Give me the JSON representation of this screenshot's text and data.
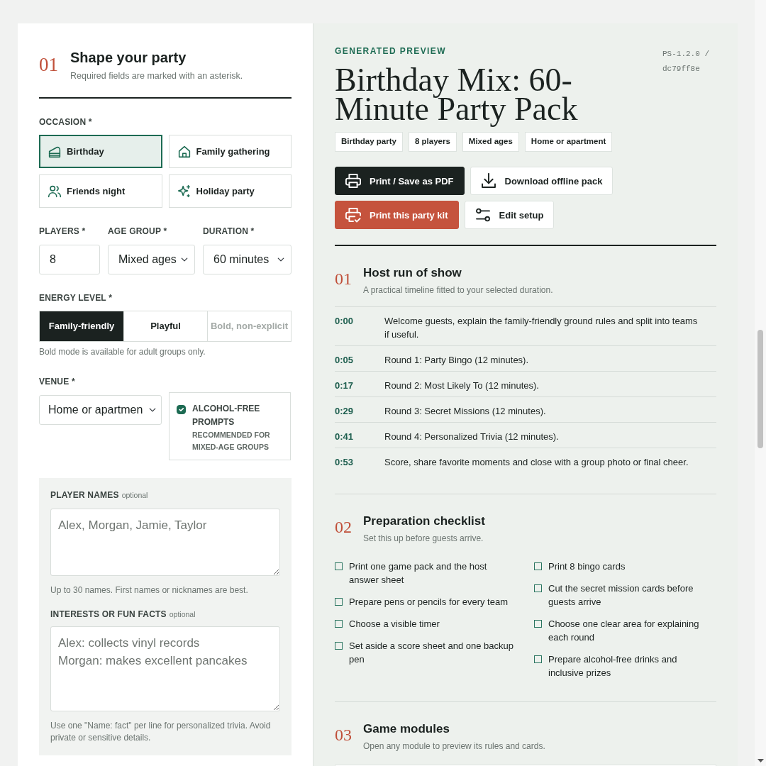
{
  "form": {
    "number": "01",
    "title": "Shape your party",
    "subtitle": "Required fields are marked with an asterisk.",
    "occasion": {
      "label": "OCCASION *",
      "options": [
        {
          "label": "Birthday",
          "selected": true
        },
        {
          "label": "Family gathering",
          "selected": false
        },
        {
          "label": "Friends night",
          "selected": false
        },
        {
          "label": "Holiday party",
          "selected": false
        }
      ]
    },
    "fields": [
      {
        "kind": "input",
        "label": "PLAYERS *",
        "value": "8"
      },
      {
        "kind": "select",
        "label": "AGE GROUP *",
        "value": "Mixed ages"
      },
      {
        "kind": "select",
        "label": "DURATION *",
        "value": "60 minutes"
      }
    ],
    "energy": {
      "label": "ENERGY LEVEL *",
      "options": [
        {
          "label": "Family-friendly",
          "selected": true,
          "disabled": false
        },
        {
          "label": "Playful",
          "selected": false,
          "disabled": false
        },
        {
          "label": "Bold, non-explicit",
          "selected": false,
          "disabled": true
        }
      ],
      "help": "Bold mode is available for adult groups only."
    },
    "venue": {
      "label": "VENUE *",
      "value": "Home or apartmen"
    },
    "alcohol_free": {
      "label": "ALCOHOL-FREE PROMPTS",
      "note": "RECOMMENDED FOR MIXED-AGE GROUPS",
      "checked": true
    },
    "optional_fields": [
      {
        "label": "PLAYER NAMES",
        "tag": "optional",
        "placeholder": "Alex, Morgan, Jamie, Taylor",
        "help": "Up to 30 names. First names or nicknames are best."
      },
      {
        "label": "INTERESTS OR FUN FACTS",
        "tag": "optional",
        "placeholder": "Alex: collects vinyl records\nMorgan: makes excellent pancakes",
        "help": "Use one \"Name: fact\" per line for personalized trivia. Avoid private or sensitive details."
      }
    ]
  },
  "preview": {
    "eyebrow": "GENERATED PREVIEW",
    "version": "PS-1.2.0 / dc79ff8e",
    "title": "Birthday Mix: 60-Minute Party Pack",
    "chips": [
      "Birthday party",
      "8 players",
      "Mixed ages",
      "Home or apartment"
    ],
    "actions": [
      [
        {
          "kind": "primary",
          "label": "Print / Save as PDF"
        },
        {
          "kind": "secondary",
          "label": "Download offline pack"
        }
      ],
      [
        {
          "kind": "accent",
          "label": "Print this party kit"
        },
        {
          "kind": "secondary",
          "label": "Edit setup"
        }
      ]
    ],
    "sections": [
      {
        "kind": "timeline",
        "number": "01",
        "title": "Host run of show",
        "subtitle": "A practical timeline fitted to your selected duration.",
        "rows": [
          {
            "time": "0:00",
            "text": "Welcome guests, explain the family-friendly ground rules and split into teams if useful."
          },
          {
            "time": "0:05",
            "text": "Round 1: Party Bingo (12 minutes)."
          },
          {
            "time": "0:17",
            "text": "Round 2: Most Likely To (12 minutes)."
          },
          {
            "time": "0:29",
            "text": "Round 3: Secret Missions (12 minutes)."
          },
          {
            "time": "0:41",
            "text": "Round 4: Personalized Trivia (12 minutes)."
          },
          {
            "time": "0:53",
            "text": "Score, share favorite moments and close with a group photo or final cheer."
          }
        ]
      },
      {
        "kind": "checklist",
        "number": "02",
        "title": "Preparation checklist",
        "subtitle": "Set this up before guests arrive.",
        "columns": [
          [
            {
              "text": "Print one game pack and the host answer sheet",
              "checked": false
            },
            {
              "text": "Prepare pens or pencils for every team",
              "checked": false
            },
            {
              "text": "Choose a visible timer",
              "checked": false
            },
            {
              "text": "Set aside a score sheet and one backup pen",
              "checked": false
            }
          ],
          [
            {
              "text": "Print 8 bingo cards",
              "checked": false
            },
            {
              "text": "Cut the secret mission cards before guests arrive",
              "checked": false
            },
            {
              "text": "Choose one clear area for explaining each round",
              "checked": false
            },
            {
              "text": "Prepare alcohol-free drinks and inclusive prizes",
              "checked": false
            }
          ]
        ]
      },
      {
        "kind": "modules",
        "number": "03",
        "title": "Game modules",
        "subtitle": "Open any module to preview its rules and cards."
      }
    ]
  }
}
